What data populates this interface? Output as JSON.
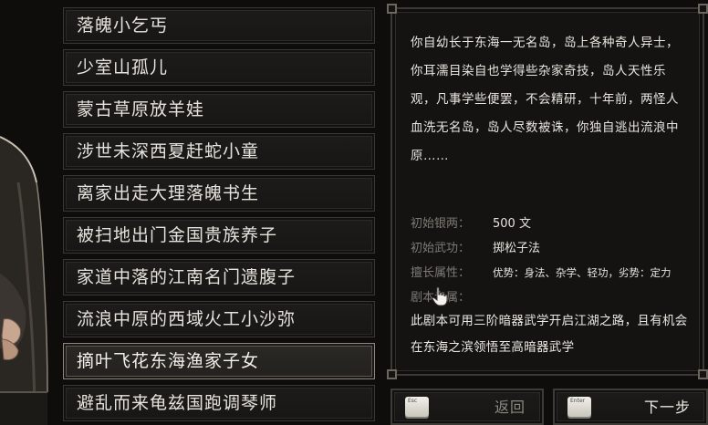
{
  "origins": [
    {
      "label": "落魄小乞丐",
      "selected": false
    },
    {
      "label": "少室山孤儿",
      "selected": false
    },
    {
      "label": "蒙古草原放羊娃",
      "selected": false
    },
    {
      "label": "涉世未深西夏赶蛇小童",
      "selected": false
    },
    {
      "label": "离家出走大理落魄书生",
      "selected": false
    },
    {
      "label": "被扫地出门金国贵族养子",
      "selected": false
    },
    {
      "label": "家道中落的江南名门遗腹子",
      "selected": false
    },
    {
      "label": "流浪中原的西域火工小沙弥",
      "selected": false
    },
    {
      "label": "摘叶飞花东海渔家子女",
      "selected": true
    },
    {
      "label": "避乱而来龟兹国跑调琴师",
      "selected": false
    }
  ],
  "description": {
    "story": "你自幼长于东海一无名岛，岛上各种奇人异士，你耳濡目染自也学得些杂家奇技，岛人天性乐观，凡事学些便罢，不会精研，十年前，两怪人血洗无名岛，岛人尽数被诛，你独自逃出流浪中原……",
    "silver_label": "初始银两：",
    "silver_value": "500 文",
    "skill_label": "初始武功：",
    "skill_value": "掷松子法",
    "attr_label": "擅长属性：",
    "attr_value": "优势：身法、杂学、轻功，劣势：定力",
    "script_label": "剧本专属：",
    "script_text": "此剧本可用三阶暗器武学开启江湖之路，且有机会在东海之滨领悟至高暗器武学"
  },
  "buttons": {
    "back_key": "Esc",
    "back_label": "返回",
    "next_key": "Enter",
    "next_label": "下一步"
  },
  "icons": {
    "cursor": "hand-pointer-icon",
    "keycap": "keycap-icon"
  },
  "colors": {
    "background": "#0e0d0c",
    "text": "#e6e3dc",
    "muted": "#7d7a73",
    "border": "#3a3833",
    "selected_border": "#8d887c"
  }
}
